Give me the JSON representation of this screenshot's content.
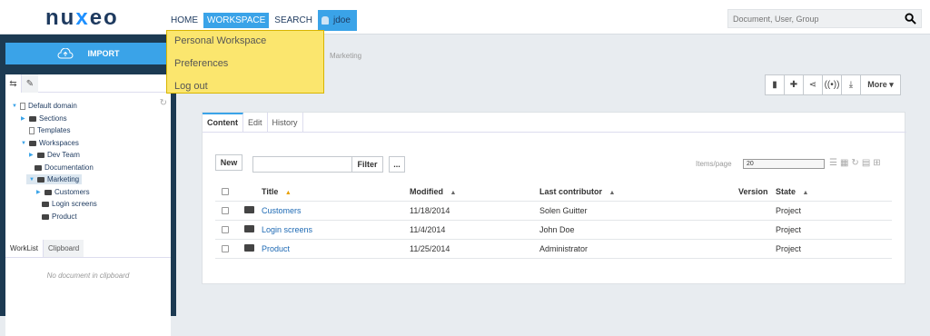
{
  "brand": {
    "logo_text_a": "nu",
    "logo_text_x": "x",
    "logo_text_b": "eo"
  },
  "nav": {
    "home": "HOME",
    "workspace": "WORKSPACE",
    "search": "SEARCH",
    "user": "jdoe"
  },
  "search": {
    "placeholder": "Document, User, Group"
  },
  "user_menu": {
    "items": [
      "Personal Workspace",
      "Preferences",
      "Log out"
    ]
  },
  "sidebar": {
    "import_label": "IMPORT",
    "tree": [
      {
        "label": "Default domain",
        "level": 0
      },
      {
        "label": "Sections",
        "level": 1
      },
      {
        "label": "Templates",
        "level": 1
      },
      {
        "label": "Workspaces",
        "level": 1
      },
      {
        "label": "Dev Team",
        "level": 2
      },
      {
        "label": "Documentation",
        "level": 2
      },
      {
        "label": "Marketing",
        "level": 2
      },
      {
        "label": "Customers",
        "level": 3
      },
      {
        "label": "Login screens",
        "level": 3
      },
      {
        "label": "Product",
        "level": 3
      }
    ],
    "worklist_tab": "WorkList",
    "clipboard_tab": "Clipboard",
    "clipboard_empty": "No document in clipboard"
  },
  "breadcrumb": "Marketing",
  "actions": {
    "more": "More ▾"
  },
  "tabs": {
    "content": "Content",
    "edit": "Edit",
    "history": "History"
  },
  "toolbar": {
    "new": "New",
    "filter": "Filter",
    "more_dots": "...",
    "items_per_page_label": "Items/page",
    "items_per_page_value": "20"
  },
  "table": {
    "headers": {
      "title": "Title",
      "modified": "Modified",
      "contributor": "Last contributor",
      "version": "Version",
      "state": "State"
    },
    "rows": [
      {
        "title": "Customers",
        "modified": "11/18/2014",
        "contributor": "Solen Guitter",
        "state": "Project"
      },
      {
        "title": "Login screens",
        "modified": "11/4/2014",
        "contributor": "John Doe",
        "state": "Project"
      },
      {
        "title": "Product",
        "modified": "11/25/2014",
        "contributor": "Administrator",
        "state": "Project"
      }
    ]
  }
}
